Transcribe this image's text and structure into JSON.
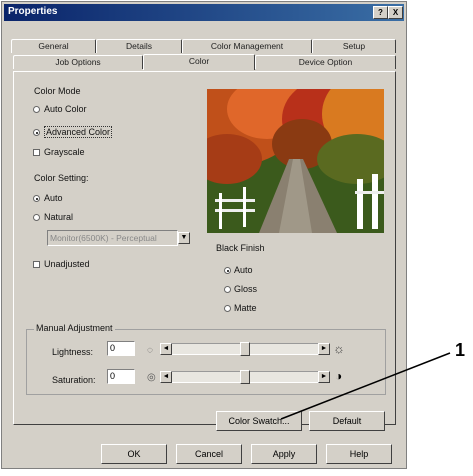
{
  "window": {
    "title": "Properties",
    "help_btn": "?",
    "close_btn": "X"
  },
  "tabs": {
    "row1": [
      "General",
      "Details",
      "Color Management",
      "Setup"
    ],
    "row2": [
      "Job Options",
      "Color",
      "Device Option"
    ],
    "active": "Color"
  },
  "color_mode": {
    "label": "Color Mode",
    "options": [
      "Auto Color",
      "Advanced Color",
      "Grayscale"
    ],
    "selected": "Advanced Color"
  },
  "color_setting": {
    "label": "Color Setting:",
    "options": [
      "Auto",
      "Natural"
    ],
    "selected": "Auto",
    "profile_value": "Monitor(6500K) - Perceptual",
    "unadjusted_label": "Unadjusted"
  },
  "black_finish": {
    "label": "Black Finish",
    "options": [
      "Auto",
      "Gloss",
      "Matte"
    ],
    "selected": "Auto"
  },
  "manual_adjustment": {
    "label": "Manual Adjustment",
    "lightness_label": "Lightness:",
    "lightness_value": "0",
    "saturation_label": "Saturation:",
    "saturation_value": "0",
    "lightness_level": 0.5,
    "saturation_level": 0.5
  },
  "buttons": {
    "color_swatch": "Color Swatch...",
    "default": "Default",
    "ok": "OK",
    "cancel": "Cancel",
    "apply": "Apply",
    "help": "Help"
  },
  "annotation": {
    "callout_number": "1"
  },
  "icons": {
    "sun": "sun-icon",
    "contrast": "half-circle-icon",
    "preview": "autumn-road-photo"
  }
}
